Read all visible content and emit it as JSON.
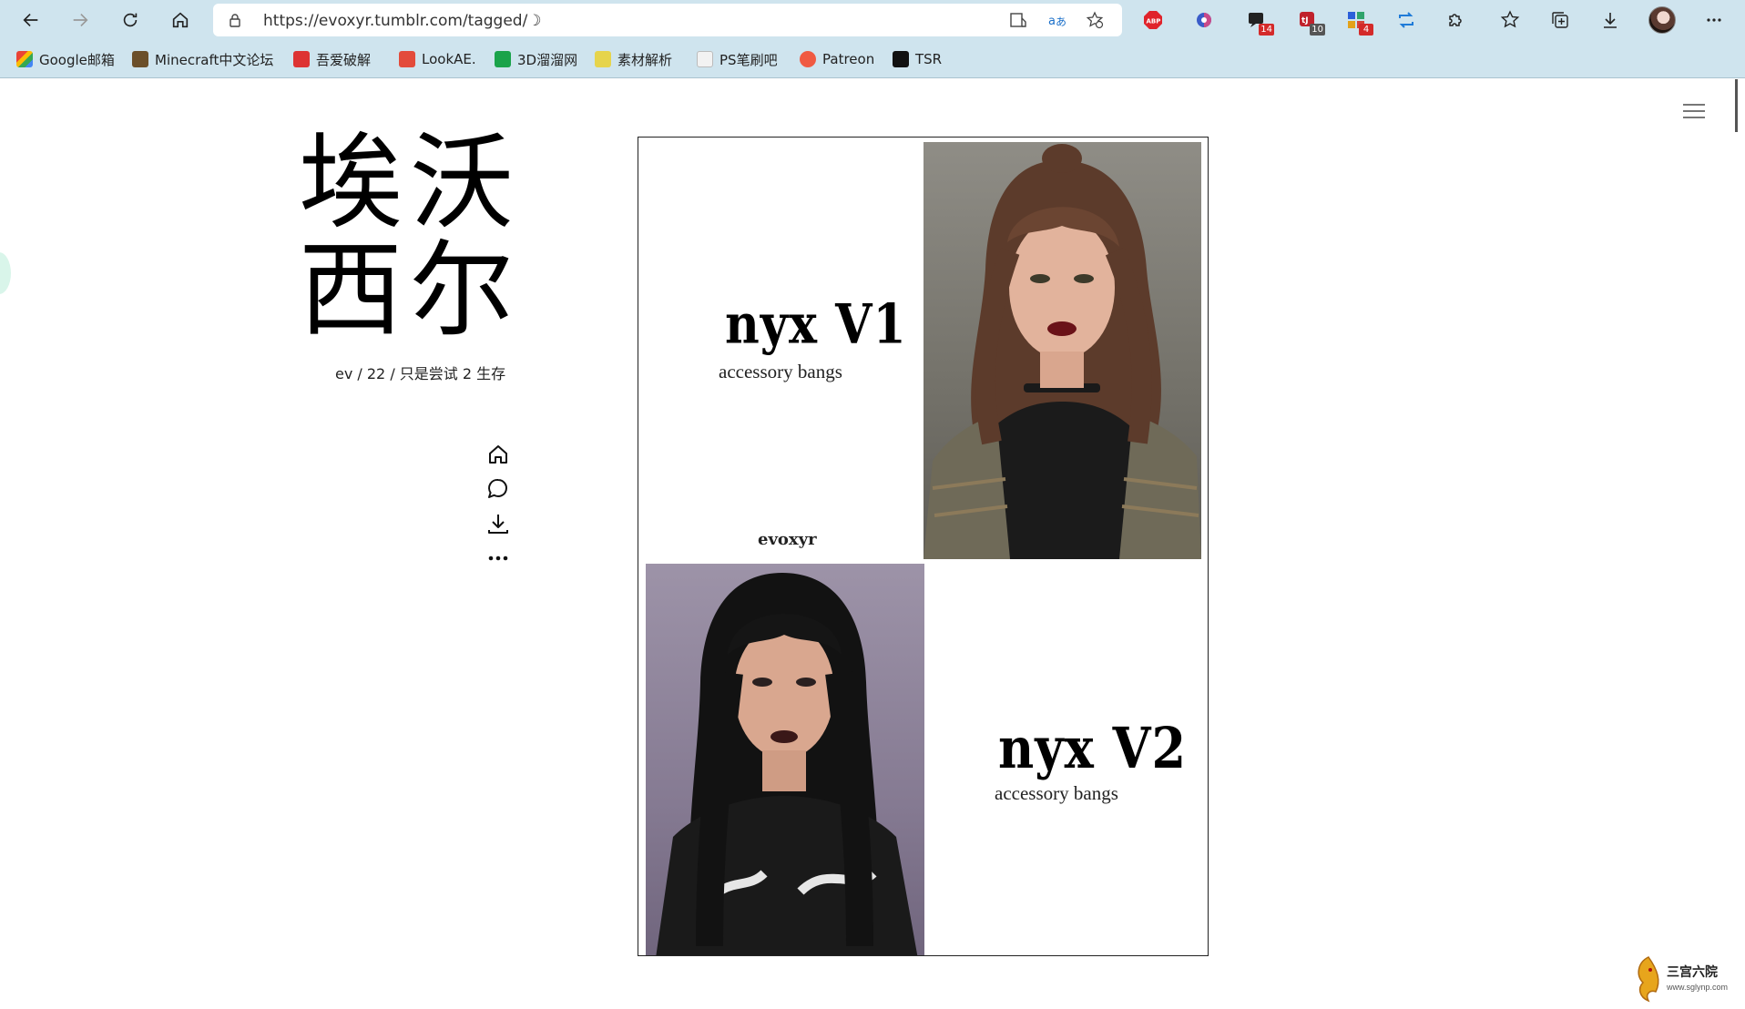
{
  "browser": {
    "url": "https://evoxyr.tumblr.com/tagged/☽",
    "extensions": [
      {
        "name": "adblock-plus-icon"
      },
      {
        "name": "color-extension-icon"
      },
      {
        "name": "chat-extension-icon",
        "badge": "14"
      },
      {
        "name": "translate-ext-icon",
        "badge": "10"
      },
      {
        "name": "apps-extension-icon",
        "badge": "4"
      },
      {
        "name": "sync-extension-icon"
      },
      {
        "name": "extensions-puzzle-icon"
      },
      {
        "name": "favorites-icon"
      },
      {
        "name": "collections-icon"
      },
      {
        "name": "downloads-icon"
      }
    ]
  },
  "bookmarks": [
    {
      "label": "Google邮箱",
      "color": "#ea4335"
    },
    {
      "label": "Minecraft中文论坛",
      "color": "#6b4f2a"
    },
    {
      "label": "吾爱破解",
      "color": "#d33"
    },
    {
      "label": "LookAE.",
      "color": "#e34b3b"
    },
    {
      "label": "3D溜溜网",
      "color": "#1aa34a"
    },
    {
      "label": "素材解析",
      "color": "#e6d44c"
    },
    {
      "label": "PS笔刷吧",
      "color": "#8a6b3a"
    },
    {
      "label": "Patreon",
      "color": "#f05a42"
    },
    {
      "label": "TSR",
      "color": "#111111"
    }
  ],
  "blog": {
    "title_line1": "埃沃",
    "title_line2": "西尔",
    "description": "ev / 22 / 只是尝试 2 生存",
    "nav_icons": [
      "home-icon",
      "message-icon",
      "download-icon",
      "more-icon"
    ]
  },
  "post": {
    "v1_title": "nyx V1",
    "v1_subtitle": "accessory bangs",
    "signature": "evoxyr",
    "v2_title": "nyx V2",
    "v2_subtitle": "accessory bangs"
  },
  "watermark": {
    "text": "三宫六院",
    "url": "www.sglynp.com"
  },
  "colors": {
    "chrome": "#cfe4ee",
    "page_bg": "#ffffff"
  }
}
